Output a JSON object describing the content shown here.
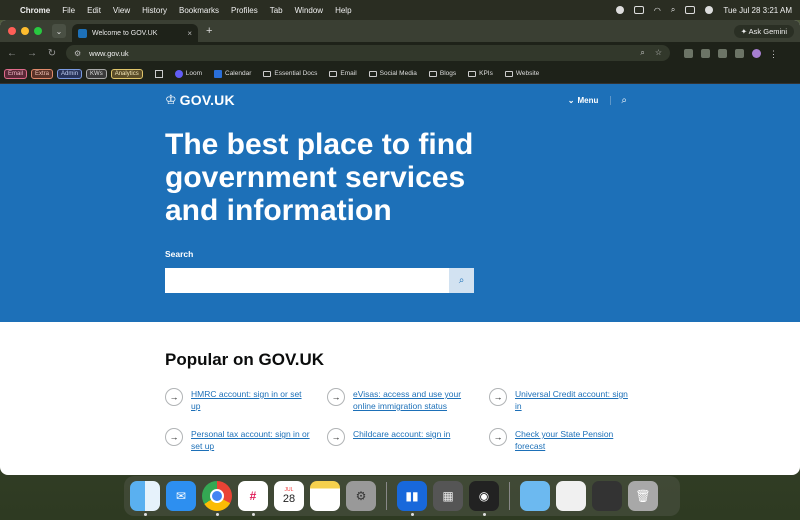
{
  "menubar": {
    "app": "Chrome",
    "items": [
      "File",
      "Edit",
      "View",
      "History",
      "Bookmarks",
      "Profiles",
      "Tab",
      "Window",
      "Help"
    ],
    "clock": "Tue Jul 28  3:21 AM"
  },
  "browser": {
    "tab_title": "Welcome to GOV.UK",
    "url": "www.gov.uk",
    "gemini_label": "Ask Gemini",
    "bookmark_pills": [
      "Email",
      "Extra",
      "Admin",
      "KWs",
      "Analytics"
    ],
    "bookmarks": [
      {
        "icon": "loom-icon",
        "label": "Loom"
      },
      {
        "icon": "calendar-icon",
        "label": "Calendar"
      },
      {
        "icon": "folder-icon",
        "label": "Essential Docs"
      },
      {
        "icon": "folder-icon",
        "label": "Email"
      },
      {
        "icon": "folder-icon",
        "label": "Social Media"
      },
      {
        "icon": "folder-icon",
        "label": "Blogs"
      },
      {
        "icon": "folder-icon",
        "label": "KPIs"
      },
      {
        "icon": "folder-icon",
        "label": "Website"
      }
    ]
  },
  "page": {
    "logo": "GOV.UK",
    "menu_label": "Menu",
    "headline": "The best place to find government services and information",
    "search_label": "Search",
    "search_value": "",
    "popular_heading": "Popular on GOV.UK",
    "popular_links": [
      "HMRC account: sign in or set up",
      "eVisas: access and use your online immigration status",
      "Universal Credit account: sign in",
      "Personal tax account: sign in or set up",
      "Childcare account: sign in",
      "Check your State Pension forecast"
    ],
    "brand_color": "#1d70b8"
  },
  "dock": {
    "calendar_month": "JUL",
    "calendar_day": "28"
  }
}
